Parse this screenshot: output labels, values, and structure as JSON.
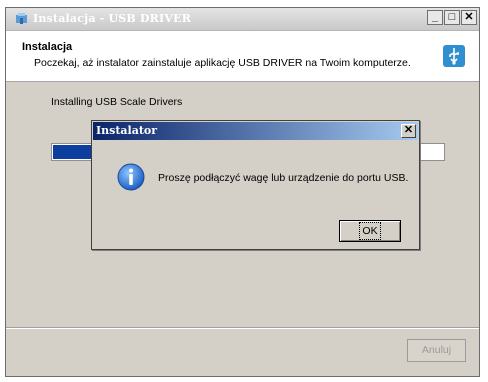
{
  "window": {
    "title": "Instalacja - USB DRIVER",
    "minimize_label": "_",
    "maximize_label": "□",
    "close_label": "✕"
  },
  "header": {
    "title": "Instalacja",
    "subtitle": "Poczekaj, aż instalator zainstaluje aplikację USB DRIVER na Twoim komputerze.",
    "icon": "usb-icon"
  },
  "content": {
    "status": "Installing USB Scale Drivers",
    "progress_fraction": 0.85
  },
  "footer": {
    "cancel_label": "Anuluj"
  },
  "dialog": {
    "title": "Instalator",
    "close_label": "✕",
    "icon": "info-icon",
    "message": "Proszę podłączyć wagę lub urządzenie do portu USB.",
    "ok_label": "OK"
  },
  "colors": {
    "progress_fill": "#0b3e9e",
    "dialog_title_start": "#0a246a",
    "dialog_title_end": "#a6caf0"
  }
}
